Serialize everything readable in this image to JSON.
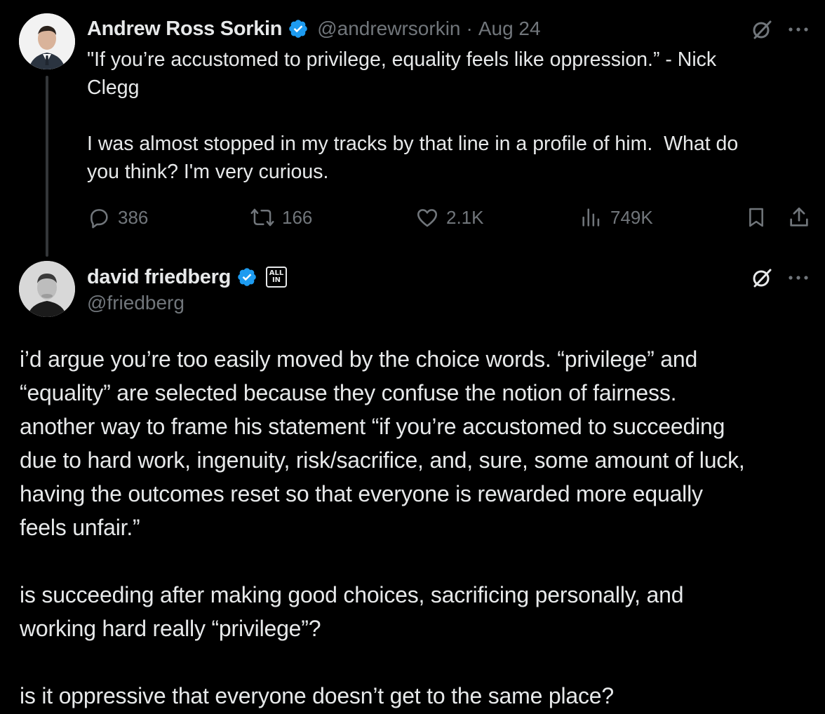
{
  "tweet1": {
    "author": "Andrew Ross Sorkin",
    "handle": "@andrewrsorkin",
    "separator": "·",
    "date": "Aug 24",
    "text": "\"If you’re accustomed to privilege, equality feels like oppression.” - Nick\nClegg\n\nI was almost stopped in my tracks by that line in a profile of him.  What do\nyou think? I'm very curious.",
    "stats": {
      "replies": "386",
      "reposts": "166",
      "likes": "2.1K",
      "views": "749K"
    },
    "icons": [
      "grok-icon",
      "more-icon",
      "reply-icon",
      "repost-icon",
      "like-icon",
      "views-icon",
      "bookmark-icon",
      "share-icon",
      "verified-icon"
    ]
  },
  "tweet2": {
    "author": "david friedberg",
    "handle": "@friedberg",
    "badge_line1": "ALL",
    "badge_line2": "IN",
    "text": "i’d argue you’re too easily moved by the choice words. “privilege” and\n“equality” are selected because they confuse the notion of fairness.\nanother way to frame his statement “if you’re accustomed to succeeding\ndue to hard work, ingenuity, risk/sacrifice, and, sure, some amount of luck,\nhaving the outcomes reset so that everyone is rewarded more equally\nfeels unfair.”\n\nis succeeding after making good choices, sacrificing personally, and\nworking hard really “privilege”?\n\nis it oppressive that everyone doesn’t get to the same place?",
    "icons": [
      "grok-icon",
      "more-icon",
      "verified-icon",
      "affiliate-badge"
    ]
  },
  "colors": {
    "background": "#000000",
    "text": "#e7e9ea",
    "secondary": "#71767b",
    "verified": "#1d9bf0",
    "thread_line": "#333639"
  }
}
